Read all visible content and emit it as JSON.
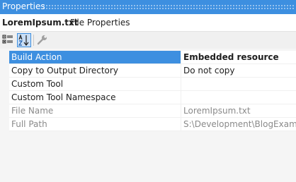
{
  "window": {
    "title": "Properties"
  },
  "object_selector": {
    "name": "LoremIpsum.txt",
    "type": "File Properties"
  },
  "toolbar": {
    "buttons": [
      {
        "icon": "categorized-icon",
        "tooltip": ""
      },
      {
        "icon": "alphabetical-sort-icon",
        "active": true
      },
      {
        "icon": "property-pages-wrench-icon",
        "enabled": false
      }
    ]
  },
  "properties": [
    {
      "name": "Build Action",
      "value": "Embedded resource",
      "selected": true,
      "readonly": false
    },
    {
      "name": "Copy to Output Directory",
      "value": "Do not copy",
      "selected": false,
      "readonly": false
    },
    {
      "name": "Custom Tool",
      "value": "",
      "selected": false,
      "readonly": false
    },
    {
      "name": "Custom Tool Namespace",
      "value": "",
      "selected": false,
      "readonly": false
    },
    {
      "name": "File Name",
      "value": "LoremIpsum.txt",
      "selected": false,
      "readonly": true
    },
    {
      "name": "Full Path",
      "value": "S:\\Development\\BlogExample",
      "selected": false,
      "readonly": true
    }
  ],
  "colors": {
    "accent": "#3d8fe0",
    "readonly_text": "#8a8a8a",
    "background": "#f5f5f5"
  }
}
